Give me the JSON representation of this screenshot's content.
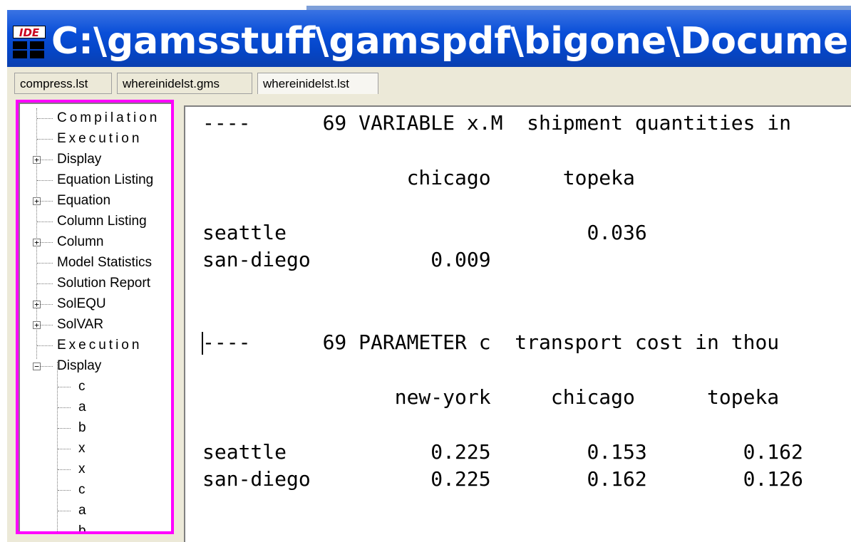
{
  "window": {
    "icon": "ide-icon",
    "icon_label": "IDE",
    "title": "C:\\gamsstuff\\gamspdf\\bigone\\Document"
  },
  "tabs": [
    {
      "label": "compress.lst"
    },
    {
      "label": "whereinidelst.gms"
    },
    {
      "label": "whereinidelst.lst"
    }
  ],
  "tree": {
    "items": [
      {
        "label": "Compilation"
      },
      {
        "label": "Execution"
      },
      {
        "label": "Display",
        "expander": "+"
      },
      {
        "label": "Equation Listing"
      },
      {
        "label": "Equation",
        "expander": "+"
      },
      {
        "label": "Column Listing"
      },
      {
        "label": "Column",
        "expander": "+"
      },
      {
        "label": "Model Statistics"
      },
      {
        "label": "Solution Report"
      },
      {
        "label": "SolEQU",
        "expander": "+"
      },
      {
        "label": "SolVAR",
        "expander": "+"
      },
      {
        "label": "Execution"
      },
      {
        "label": "Display",
        "expander": "−"
      }
    ],
    "children": [
      {
        "label": "c"
      },
      {
        "label": "a"
      },
      {
        "label": "b"
      },
      {
        "label": "x"
      },
      {
        "label": "x"
      },
      {
        "label": "c"
      },
      {
        "label": "a"
      },
      {
        "label": "b"
      }
    ]
  },
  "listing": {
    "lines": [
      "----      69 VARIABLE x.M  shipment quantities in",
      "                 chicago      topeka",
      "seattle                         0.036",
      "san-diego          0.009",
      "----      69 PARAMETER c  transport cost in thou",
      "                new-york     chicago      topeka",
      "seattle            0.225        0.153        0.162",
      "san-diego          0.225        0.162        0.126"
    ]
  },
  "colors": {
    "highlight_box": "#ff00ff",
    "titlebar": "#0546c8"
  }
}
